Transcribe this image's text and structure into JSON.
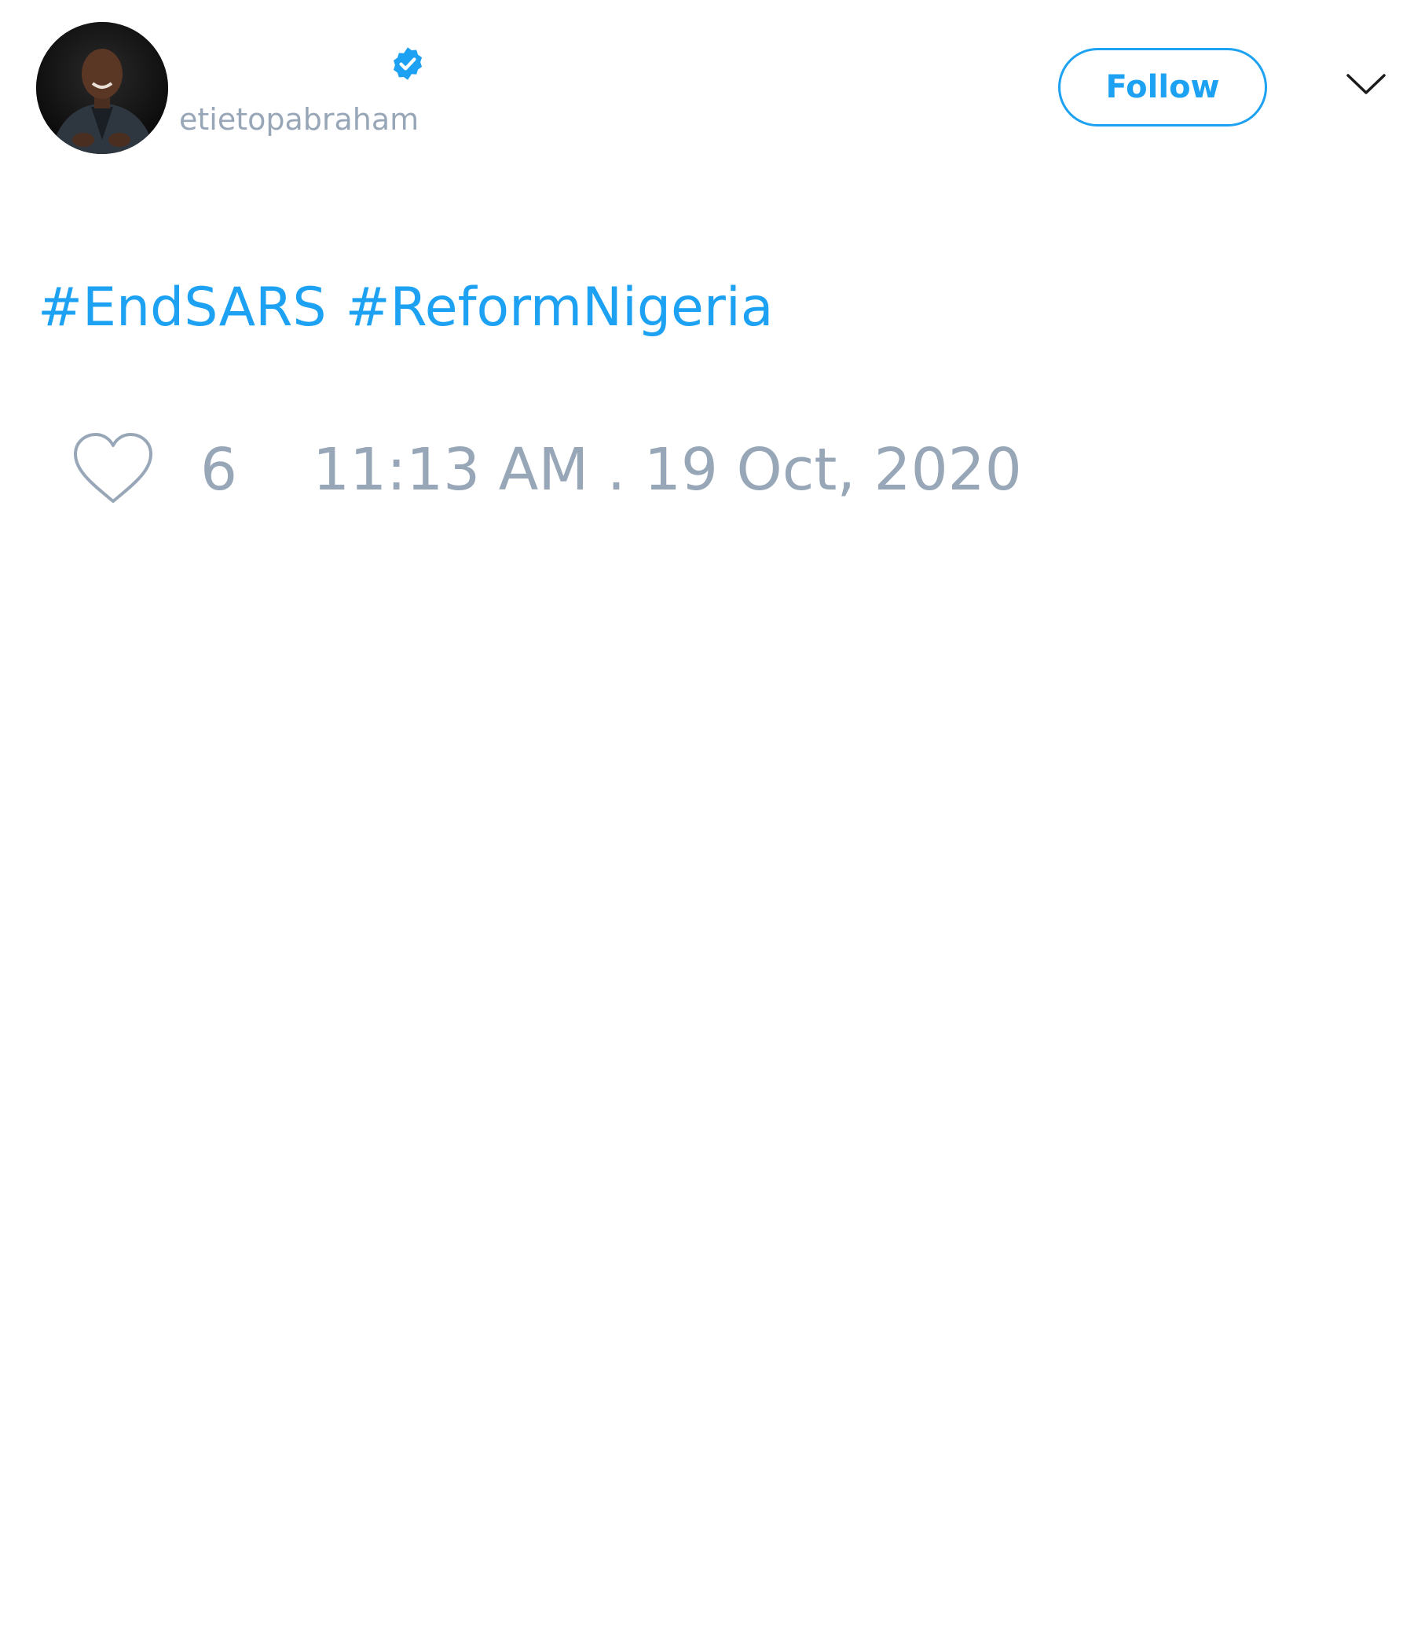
{
  "author": {
    "handle": "etietopabraham",
    "verified": true
  },
  "actions": {
    "follow_label": "Follow"
  },
  "tweet": {
    "hashtags": [
      "#EndSARS",
      "#ReformNigeria"
    ]
  },
  "meta": {
    "like_count": "6",
    "timestamp": "11:13 AM . 19 Oct, 2020"
  },
  "icons": {
    "avatar": "profile-photo",
    "verified": "verified-badge-icon",
    "chevron": "chevron-down-icon",
    "like": "heart-outline-icon"
  },
  "colors": {
    "accent": "#1da1f2",
    "muted_text": "#98a7b8",
    "background": "#ffffff"
  }
}
